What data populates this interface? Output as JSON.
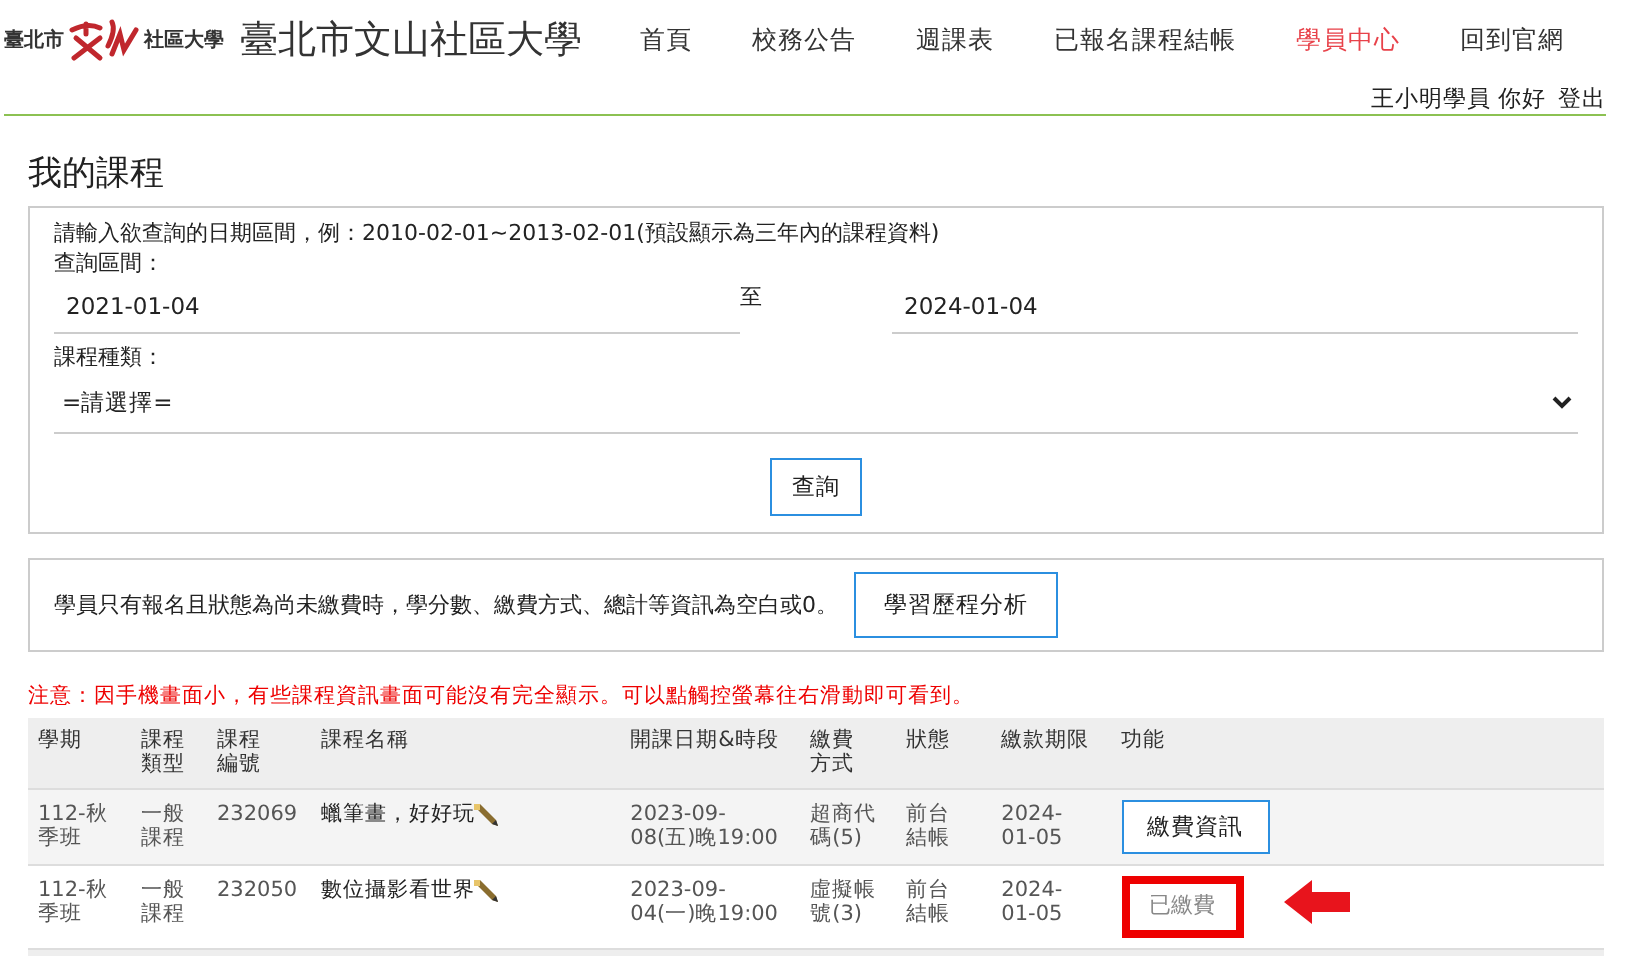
{
  "header": {
    "logo_left": "臺北市",
    "logo_right": "社區大學",
    "site_title": "臺北市文山社區大學",
    "nav": [
      {
        "label": "首頁",
        "selected": false
      },
      {
        "label": "校務公告",
        "selected": false
      },
      {
        "label": "週課表",
        "selected": false
      },
      {
        "label": "已報名課程結帳",
        "selected": false
      },
      {
        "label": "學員中心",
        "selected": true
      },
      {
        "label": "回到官網",
        "selected": false
      }
    ],
    "user_greeting": "王小明學員 你好",
    "logout": "登出"
  },
  "page_title": "我的課程",
  "query": {
    "hint": "請輸入欲查詢的日期區間，例：2010-02-01~2013-02-01(預設顯示為三年內的課程資料)",
    "range_label": "查詢區間：",
    "start_date": "2021-01-04",
    "to_label": "至",
    "end_date": "2024-01-04",
    "type_label": "課程種類：",
    "type_value": "=請選擇=",
    "search_button": "查詢"
  },
  "info": {
    "text": "學員只有報名且狀態為尚未繳費時，學分數、繳費方式、總計等資訊為空白或0。",
    "button": "學習歷程分析"
  },
  "notice": "注意：因手機畫面小，有些課程資訊畫面可能沒有完全顯示。可以點觸控螢幕往右滑動即可看到。",
  "table": {
    "columns": [
      "學期",
      "課程類型",
      "課程編號",
      "課程名稱",
      "開課日期&時段",
      "繳費方式",
      "狀態",
      "繳款期限",
      "功能"
    ],
    "rows": [
      {
        "term": "112-秋季班",
        "type": "一般課程",
        "code": "232069",
        "name": "蠟筆畫，好好玩",
        "date": "2023-09-08(五)晚19:00",
        "payment": "超商代碼(5)",
        "status": "前台結帳",
        "deadline": "2024-01-05",
        "action": {
          "kind": "button",
          "label": "繳費資訊",
          "highlighted": false
        }
      },
      {
        "term": "112-秋季班",
        "type": "一般課程",
        "code": "232050",
        "name": "數位攝影看世界",
        "date": "2023-09-04(一)晚19:00",
        "payment": "虛擬帳號(3)",
        "status": "前台結帳",
        "deadline": "2024-01-05",
        "action": {
          "kind": "paid",
          "label": "已繳費",
          "highlighted": true
        }
      }
    ]
  }
}
